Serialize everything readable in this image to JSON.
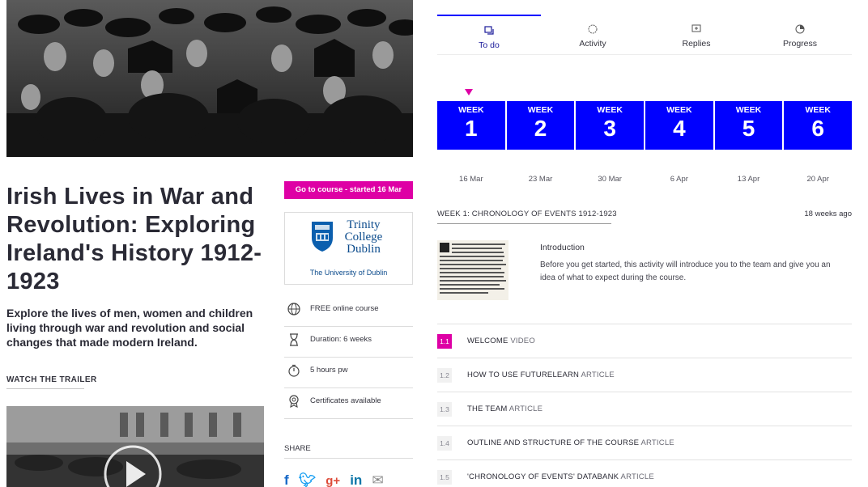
{
  "left": {
    "hero_alt": "crowd photograph",
    "course": {
      "title": "Irish Lives in War and Revolution: Exploring Ireland's History 1912-1923",
      "description": "Explore the lives of men, women and children living through war and revolution and social changes that made modern Ireland."
    },
    "trailer_label": "WATCH THE TRAILER",
    "goto_button": "Go to course - started 16 Mar",
    "university": {
      "name": "Trinity College Dublin",
      "subtitle": "The University of Dublin"
    },
    "facts": [
      {
        "icon": "globe-icon",
        "text": "FREE online course"
      },
      {
        "icon": "hourglass-icon",
        "text": "Duration: 6 weeks"
      },
      {
        "icon": "stopwatch-icon",
        "text": "5 hours pw"
      },
      {
        "icon": "certificate-icon",
        "text": "Certificates available"
      }
    ],
    "share_label": "SHARE",
    "share_icons": [
      "facebook-icon",
      "twitter-icon",
      "google-plus-icon",
      "linkedin-icon",
      "mail-icon"
    ]
  },
  "right": {
    "tabs": [
      {
        "label": "To do",
        "icon": "todo-icon",
        "active": true
      },
      {
        "label": "Activity",
        "icon": "activity-icon",
        "active": false
      },
      {
        "label": "Replies",
        "icon": "replies-icon",
        "active": false
      },
      {
        "label": "Progress",
        "icon": "progress-icon",
        "active": false
      }
    ],
    "week_word": "WEEK",
    "weeks": [
      {
        "num": "1",
        "date": "16 Mar"
      },
      {
        "num": "2",
        "date": "23 Mar"
      },
      {
        "num": "3",
        "date": "30 Mar"
      },
      {
        "num": "4",
        "date": "6 Apr"
      },
      {
        "num": "5",
        "date": "13 Apr"
      },
      {
        "num": "6",
        "date": "20 Apr"
      }
    ],
    "section": {
      "title": "WEEK 1: CHRONOLOGY OF EVENTS 1912-1923",
      "ago": "18 weeks ago"
    },
    "intro": {
      "title": "Introduction",
      "text": "Before you get started, this activity will introduce you to the team and give you an idea of what to expect during the course."
    },
    "steps": [
      {
        "num": "1.1",
        "title": "WELCOME",
        "type": "VIDEO",
        "current": true
      },
      {
        "num": "1.2",
        "title": "HOW TO USE FUTURELEARN",
        "type": "ARTICLE",
        "current": false
      },
      {
        "num": "1.3",
        "title": "THE TEAM",
        "type": "ARTICLE",
        "current": false
      },
      {
        "num": "1.4",
        "title": "OUTLINE AND STRUCTURE OF THE COURSE",
        "type": "ARTICLE",
        "current": false
      },
      {
        "num": "1.5",
        "title": "'CHRONOLOGY OF EVENTS' DATABANK",
        "type": "ARTICLE",
        "current": false
      }
    ],
    "colors": {
      "week_blue": "#0000ff",
      "accent_pink": "#de00a5"
    }
  }
}
